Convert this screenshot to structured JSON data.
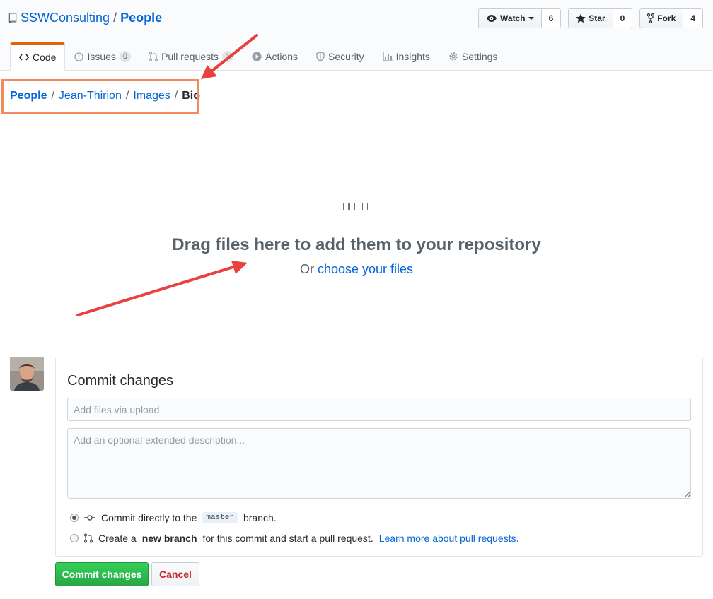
{
  "repo": {
    "owner": "SSWConsulting",
    "separator": "/",
    "name": "People"
  },
  "actions": [
    {
      "label": "Watch",
      "count": "6",
      "icon": "eye-icon"
    },
    {
      "label": "Star",
      "count": "0",
      "icon": "star-icon"
    },
    {
      "label": "Fork",
      "count": "4",
      "icon": "fork-icon"
    }
  ],
  "tabs": [
    {
      "label": "Code",
      "selected": true
    },
    {
      "label": "Issues",
      "counter": "0"
    },
    {
      "label": "Pull requests",
      "counter": "1"
    },
    {
      "label": "Actions"
    },
    {
      "label": "Security"
    },
    {
      "label": "Insights"
    },
    {
      "label": "Settings"
    }
  ],
  "breadcrumb": [
    "People",
    "Jean-Thirion",
    "Images",
    "Bio"
  ],
  "dropzone": {
    "title": "Drag files here to add them to your repository",
    "or": "Or",
    "link": "choose your files"
  },
  "commit": {
    "title": "Commit changes",
    "summary_placeholder": "Add files via upload",
    "description_placeholder": "Add an optional extended description...",
    "option_direct_prefix": "Commit directly to the",
    "branch": "master",
    "option_direct_suffix": "branch.",
    "option_new_prefix": "Create a",
    "option_new_bold": "new branch",
    "option_new_suffix": "for this commit and start a pull request.",
    "learn_more": "Learn more about pull requests.",
    "submit": "Commit changes",
    "cancel": "Cancel"
  },
  "colors": {
    "link": "#0366d6",
    "tab_accent": "#e36209",
    "annotation_arrow": "#e8413e",
    "annotation_box": "#f08b5e",
    "commit_green": "#28a745",
    "cancel_red": "#cb2431"
  }
}
